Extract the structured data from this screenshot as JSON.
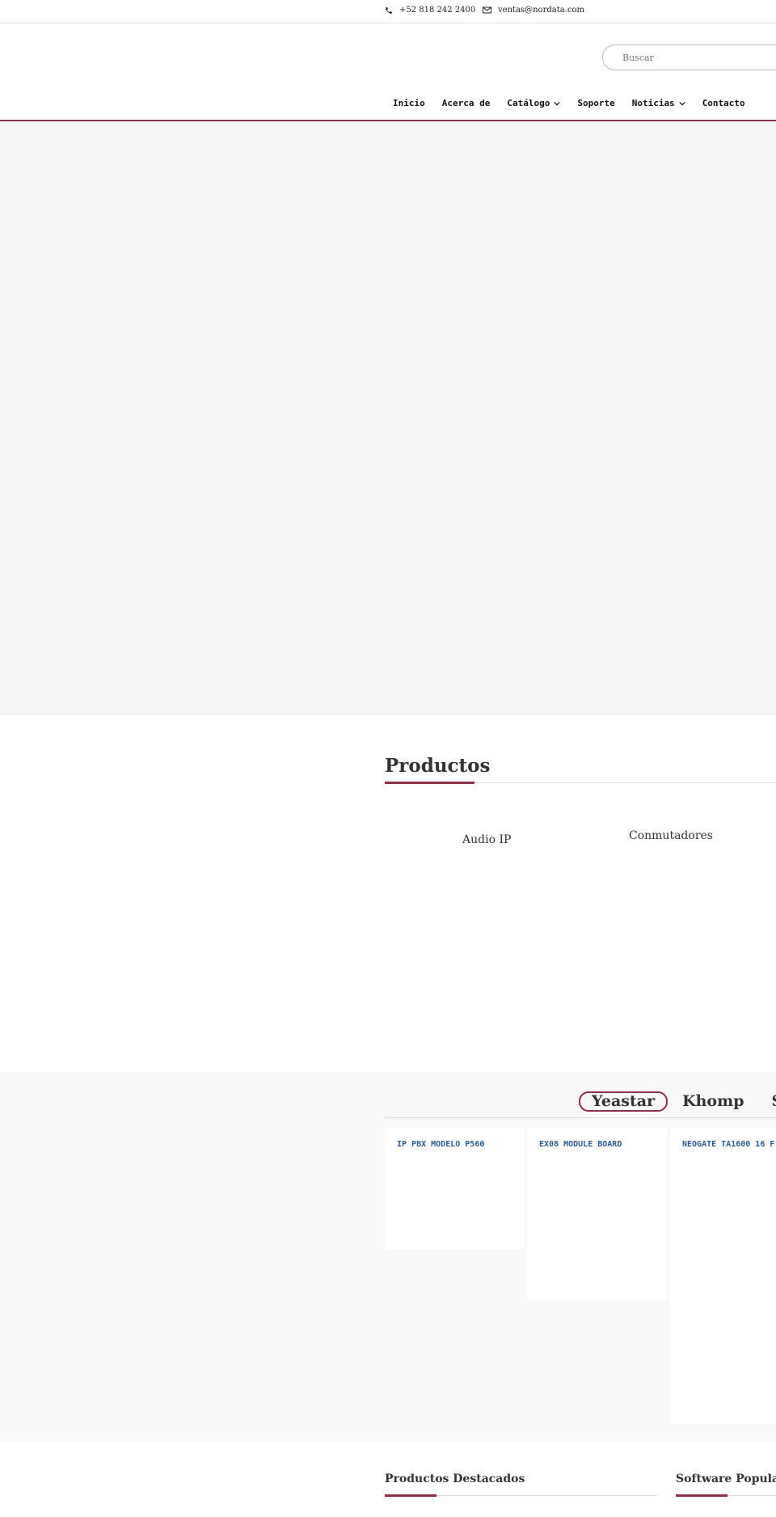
{
  "topbar": {
    "phone": "+52 818 242 2400",
    "email": "ventas@nordata.com"
  },
  "header": {
    "search_placeholder": "Buscar",
    "nav": [
      {
        "label": "Inicio",
        "dropdown": false
      },
      {
        "label": "Acerca de",
        "dropdown": false
      },
      {
        "label": "Catálogo",
        "dropdown": true
      },
      {
        "label": "Soporte",
        "dropdown": false
      },
      {
        "label": "Noticias",
        "dropdown": true
      },
      {
        "label": "Contacto",
        "dropdown": false
      }
    ]
  },
  "products": {
    "title": "Productos",
    "categories": [
      "Audio IP",
      "Conmutadores"
    ]
  },
  "brands": {
    "tabs": [
      "Yeastar",
      "Khomp",
      "S"
    ],
    "active": "Yeastar",
    "items": [
      "IP PBX MODELO P560",
      "EX08 MODULE BOARD",
      "NEOGATE TA1600 16 F"
    ]
  },
  "bottom": {
    "featured_title": "Productos Destacados",
    "software_title": "Software Popular"
  },
  "colors": {
    "accent": "#8e2f45",
    "link": "#2a5d8f",
    "hero_bg": "#f4f4f4",
    "brands_bg": "#f8f8f8"
  },
  "icons": [
    "phone-icon",
    "envelope-icon",
    "chevron-down-icon"
  ]
}
